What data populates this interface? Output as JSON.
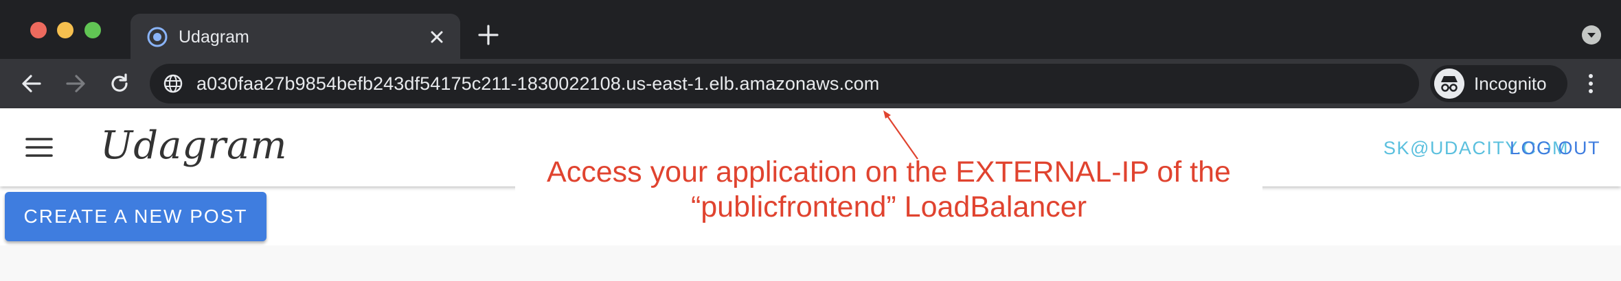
{
  "browser": {
    "tab": {
      "title": "Udagram",
      "favicon": "chrome-globe-icon",
      "close_icon": "close-icon"
    },
    "new_tab_icon": "plus-icon",
    "tab_search_icon": "chevron-down-icon",
    "nav": {
      "back_icon": "back-arrow-icon",
      "forward_icon": "forward-arrow-icon",
      "reload_icon": "reload-icon"
    },
    "address_bar": {
      "site_icon": "globe-icon",
      "url": "a030faa27b9854befb243df54175c211-1830022108.us-east-1.elb.amazonaws.com"
    },
    "profile": {
      "label": "Incognito",
      "icon": "incognito-icon"
    },
    "menu_icon": "more-vert-icon"
  },
  "app": {
    "brand": "Udagram",
    "menu_icon": "hamburger-menu-icon",
    "user_email": "SK@UDACITY.COM",
    "logout_label": "LOG OUT",
    "create_post_label": "CREATE A NEW POST"
  },
  "annotation": {
    "line1": "Access your application on the EXTERNAL-IP of the",
    "line2": "“publicfrontend” LoadBalancer"
  },
  "colors": {
    "tabstrip": "#202124",
    "toolbar": "#35363a",
    "primary_button": "#3f7ddf",
    "email_link": "#5bc0de",
    "annotation": "#e0432f"
  }
}
